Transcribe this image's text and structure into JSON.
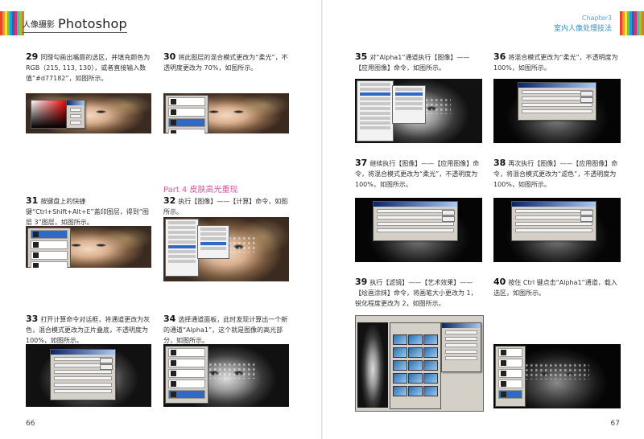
{
  "left_page": {
    "header_category": "人像摄影",
    "header_title": "Photoshop",
    "page_number": "66",
    "part_heading": "Part 4 皮肤高光重现",
    "steps": [
      {
        "num": "29",
        "text": "同理勾画出嘴唇的选区，并填充颜色为 RGB（215, 113, 130），或者直接输入数值“#d77182”，如图所示。"
      },
      {
        "num": "30",
        "text": "将此图层的混合模式更改为“柔光”，不透明度更改为 70%，如图所示。"
      },
      {
        "num": "31",
        "text": "按键盘上的快捷键“Ctrl+Shift+Alt+E”盖印图层，得到“图层 3”图层，如图所示。"
      },
      {
        "num": "32",
        "text": "执行【图像】——【计算】命令，如图所示。"
      },
      {
        "num": "33",
        "text": "打开计算命令对话框，将通道更改为灰色，混合模式更改为正片叠底，不透明度为 100%，如图所示。"
      },
      {
        "num": "34",
        "text": "选择通道面板，此时发现计算出一个新的通道“Alpha1”，这个就是图像的高光部分，如图所示。"
      }
    ]
  },
  "right_page": {
    "chapter": "Chapter3",
    "title": "室内人像处理技法",
    "page_number": "67",
    "steps": [
      {
        "num": "35",
        "text": "对“Alpha1”通道执行【图像】——【应用图像】命令，如图所示。"
      },
      {
        "num": "36",
        "text": "将混合模式更改为“柔光”，不透明度为 100%，如图所示。"
      },
      {
        "num": "37",
        "text": "继续执行【图像】——【应用图像】命令，将混合模式更改为“柔光”，不透明度为 100%，如图所示。"
      },
      {
        "num": "38",
        "text": "再次执行【图像】——【应用图像】命令，将混合模式更改为“滤色”，不透明度为 100%，如图所示。"
      },
      {
        "num": "39",
        "text": "执行【滤镜】——【艺术效果】——【绘画涂抹】命令，将画笔大小更改为 1，锐化程度更改为 2，如图所示。"
      },
      {
        "num": "40",
        "text": "按住 Ctrl 键点击“Alpha1”通道，载入选区，如图所示。"
      }
    ]
  },
  "colors": {
    "part_heading": "#d15a9a",
    "chapter_accent": "#3c8fc6",
    "stripes": [
      "#e8452c",
      "#f29c1f",
      "#f6e03a",
      "#7cc242",
      "#1aa0d8",
      "#5a4fa0",
      "#d8327a",
      "#48b8b0",
      "#9ac33c",
      "#f07030"
    ]
  }
}
